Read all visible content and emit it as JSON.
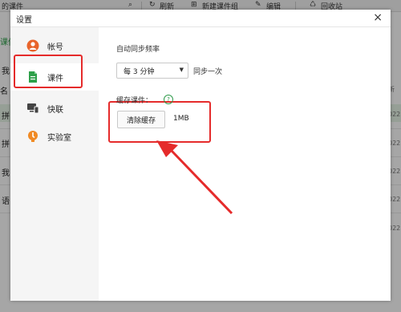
{
  "window": {
    "title": "设置",
    "close_label": "×"
  },
  "background": {
    "breadcrumb": "的课件",
    "toolbar": {
      "refresh": "刷新",
      "new_group": "新建课件组",
      "edit": "编辑",
      "recycle": "回收站"
    },
    "left_labels": [
      "课件",
      "我",
      "名",
      "拼",
      "拼",
      "我",
      "语"
    ],
    "right_labels": [
      "新",
      "022",
      "022",
      "022",
      "022",
      "022"
    ]
  },
  "sidebar": {
    "items": [
      {
        "label": "帐号",
        "icon": "account-icon",
        "color": "#e8642b"
      },
      {
        "label": "课件",
        "icon": "courseware-icon",
        "color": "#2ea04a"
      },
      {
        "label": "快联",
        "icon": "quicklink-icon",
        "color": "#444444"
      },
      {
        "label": "实验室",
        "icon": "lab-icon",
        "color": "#f08a24"
      }
    ],
    "active_index": 1
  },
  "content": {
    "sync_label": "自动同步频率",
    "sync_value": "每 3 分钟",
    "sync_suffix": "同步一次",
    "cache_label": "缓存课件：",
    "help_symbol": "?",
    "clear_button": "清除缓存",
    "cache_size": "1MB"
  },
  "colors": {
    "highlight": "#e52b2b",
    "accent": "#2ea04a"
  }
}
